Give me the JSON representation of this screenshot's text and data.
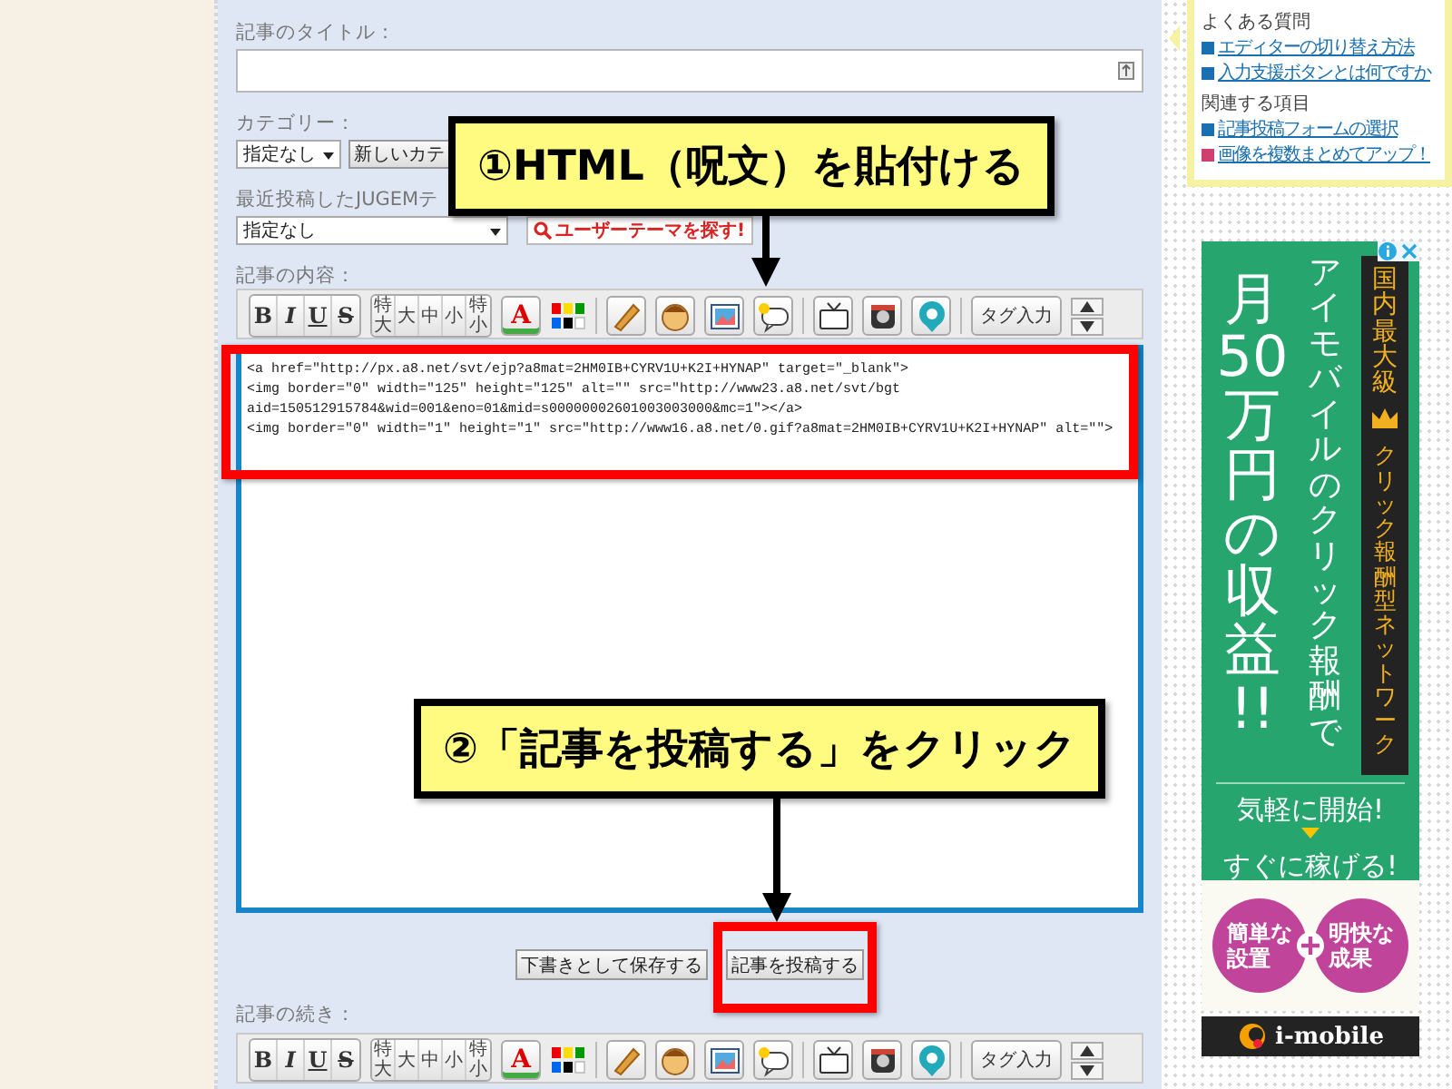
{
  "form": {
    "title_label": "記事のタイトル：",
    "category_label": "カテゴリー：",
    "category_select": "指定なし",
    "new_category_button": "新しいカテ",
    "theme_label": "最近投稿したJUGEMテ",
    "theme_select": "指定なし",
    "find_theme_button": "ユーザーテーマを探す!",
    "content_label": "記事の内容：",
    "toolbars": [
      {
        "format": [
          {
            "label": "B",
            "kind": "bold"
          },
          {
            "label": "I",
            "kind": "italic"
          },
          {
            "label": "U",
            "kind": "underline"
          },
          {
            "label": "S",
            "kind": "strike"
          }
        ],
        "sizes": [
          "特大",
          "大",
          "中",
          "小",
          "特小"
        ],
        "color_button": "A",
        "tag_button": "タグ入力"
      },
      {
        "format": [
          {
            "label": "B",
            "kind": "bold"
          },
          {
            "label": "I",
            "kind": "italic"
          },
          {
            "label": "U",
            "kind": "underline"
          },
          {
            "label": "S",
            "kind": "strike"
          }
        ],
        "sizes": [
          "特大",
          "大",
          "中",
          "小",
          "特小"
        ],
        "color_button": "A",
        "tag_button": "タグ入力"
      }
    ],
    "content_lines": [
      "<a href=\"http://px.a8.net/svt/ejp?a8mat=2HM0IB+CYRV1U+K2I+HYNAP\" target=\"_blank\">",
      "<img border=\"0\" width=\"125\" height=\"125\" alt=\"\" src=\"http://www23.a8.net/svt/bgt",
      "aid=150512915784&wid=001&eno=01&mid=s00000002601003003000&mc=1\"></a>",
      "<img border=\"0\" width=\"1\" height=\"1\" src=\"http://www16.a8.net/0.gif?a8mat=2HM0IB+CYRV1U+K2I+HYNAP\" alt=\"\">"
    ],
    "buttons": [
      "下書きとして保存する",
      "記事を投稿する"
    ],
    "continuation_label": "記事の続き："
  },
  "callouts": [
    {
      "text": "①HTML（呪文）を貼付ける"
    },
    {
      "text": "②「記事を投稿する」をクリック"
    }
  ],
  "help": {
    "sections": [
      {
        "heading": "よくある質問",
        "links": [
          {
            "text": "エディターの切り替え方法",
            "color": "#1a6fb0"
          },
          {
            "text": "入力支援ボタンとは何ですか",
            "color": "#1a6fb0"
          }
        ]
      },
      {
        "heading": "関連する項目",
        "links": [
          {
            "text": "記事投稿フォームの選択",
            "color": "#1a6fb0"
          },
          {
            "text": "画像を複数まとめてアップ！",
            "color": "#d0406e"
          }
        ]
      }
    ]
  },
  "ad": {
    "headline": "月50万円の収益!!",
    "subline": "アイモバイルのクリック報酬で",
    "badge_top": "国内最大級",
    "badge_bottom": "クリック報酬型ネットワーク",
    "cta_lines": [
      "気軽に開始!",
      "すぐに稼げる!"
    ],
    "bubbles": [
      [
        "簡単な",
        "設置"
      ],
      [
        "明快な",
        "成果"
      ]
    ],
    "brand": "i-mobile"
  }
}
